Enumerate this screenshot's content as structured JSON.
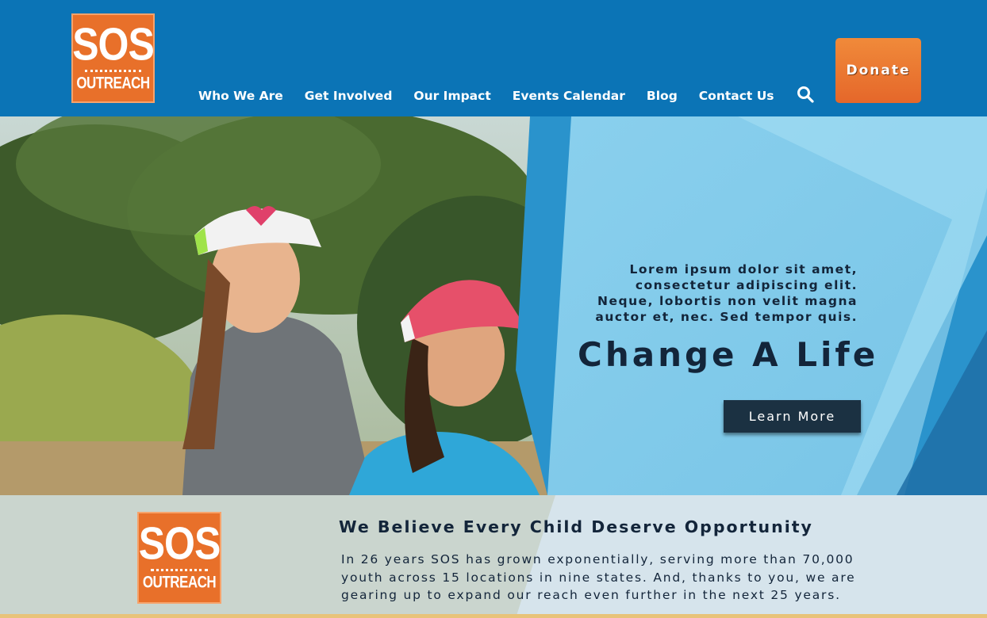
{
  "brand": {
    "logo_top": "SOS",
    "logo_bottom": "OUTREACH",
    "primary_color": "#0b74b6",
    "accent_color": "#e8702a"
  },
  "nav": {
    "items": [
      {
        "label": "Who We Are"
      },
      {
        "label": "Get Involved"
      },
      {
        "label": "Our Impact"
      },
      {
        "label": "Events Calendar"
      },
      {
        "label": "Blog"
      },
      {
        "label": "Contact Us"
      }
    ],
    "search_icon": "search-icon",
    "donate_label": "Donate"
  },
  "hero": {
    "subtitle_lines": [
      "Lorem ipsum dolor sit amet,",
      "consectetur adipiscing elit.",
      "Neque, lobortis non velit magna",
      "auctor et, nec. Sed tempor quis."
    ],
    "title": "Change A Life",
    "cta_label": "Learn More"
  },
  "mission": {
    "title": "We Believe Every Child Deserve Opportunity",
    "body_lines": [
      "In 26 years SOS has grown exponentially, serving more than 70,000",
      "youth across 15 locations in nine states. And, thanks to you, we are",
      "gearing up to expand our reach even further in the next 25 years."
    ]
  }
}
